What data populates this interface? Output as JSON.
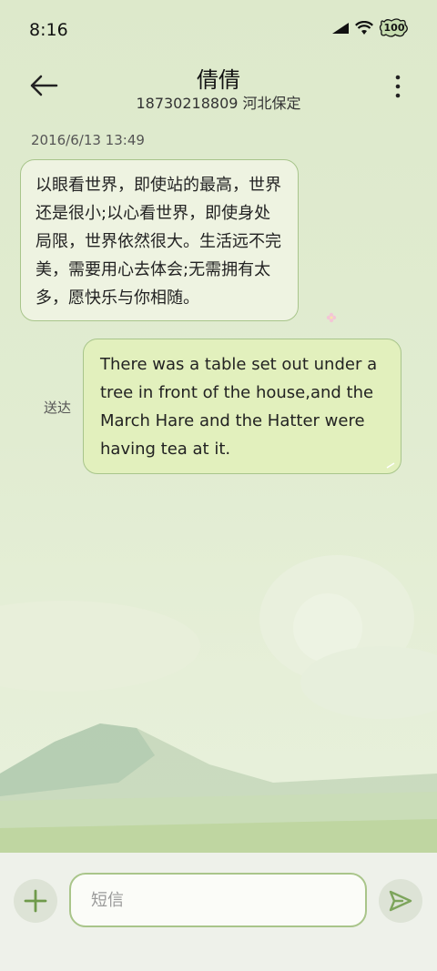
{
  "status_bar": {
    "time": "8:16",
    "battery_level": "100",
    "icons": [
      "signal-icon",
      "wifi-icon",
      "battery-icon"
    ]
  },
  "header": {
    "contact_name": "倩倩",
    "contact_info": "18730218809 河北保定",
    "icons": [
      "back-arrow-icon",
      "more-vert-icon"
    ]
  },
  "conversation": {
    "timestamp": "2016/6/13 13:49",
    "messages": [
      {
        "direction": "incoming",
        "text": "以眼看世界，即使站的最高，世界还是很小;以心看世界，即使身处局限，世界依然很大。生活远不完美，需要用心去体会;无需拥有太多，愿快乐与你相随。"
      },
      {
        "direction": "outgoing",
        "status": "送达",
        "text": "There was a table set out under a tree in front of the house,and the March Hare and the Hatter were having tea at it."
      }
    ]
  },
  "composer": {
    "placeholder": "短信",
    "value": "",
    "icons": [
      "plus-icon",
      "send-icon"
    ]
  },
  "colors": {
    "accent": "#7da55c",
    "bubble_border": "#a8c58b",
    "incoming_bubble": "#eef3e1",
    "outgoing_bubble": "#e2f0bd"
  }
}
